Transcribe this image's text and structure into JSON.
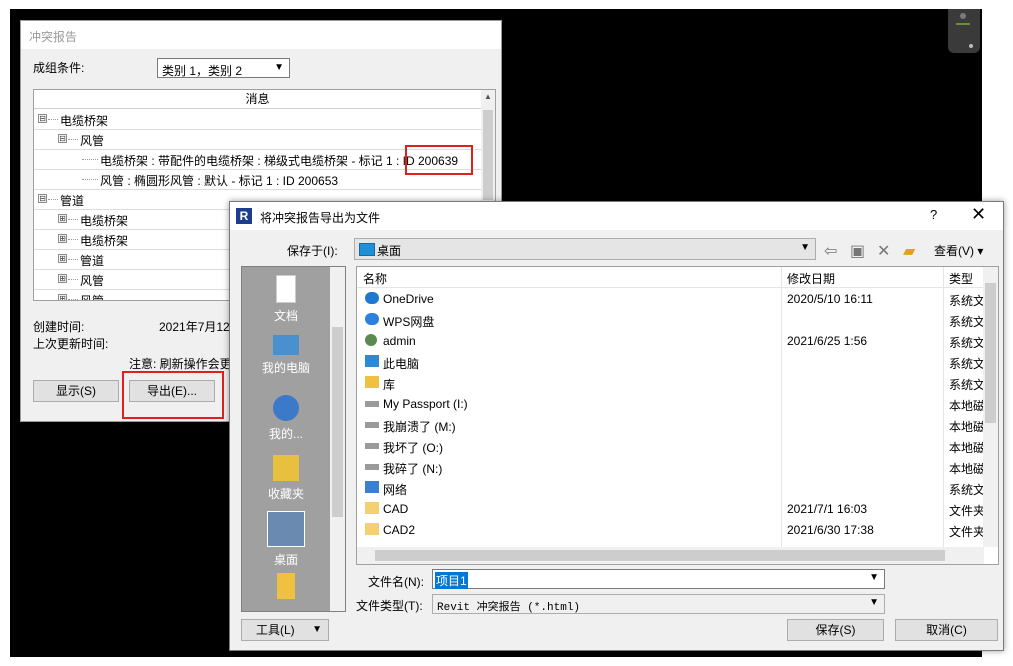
{
  "clash_report": {
    "title": "冲突报告",
    "group_by_label": "成组条件:",
    "group_by_value": "类别 1，类别 2",
    "tree_header": "消息",
    "tree": [
      {
        "label": "电缆桥架",
        "toggle": "⊟",
        "level": 0
      },
      {
        "label": "风管",
        "toggle": "⊟",
        "level": 1
      },
      {
        "label": "电缆桥架 : 带配件的电缆桥架 : 梯级式电缆桥架 - 标记 1 : ID 200639",
        "toggle": "",
        "level": 2
      },
      {
        "label": "风管 : 椭圆形风管 : 默认 - 标记 1 : ID 200653",
        "toggle": "",
        "level": 2
      },
      {
        "label": "管道",
        "toggle": "⊟",
        "level": 0
      },
      {
        "label": "电缆桥架",
        "toggle": "⊞",
        "level": 1
      },
      {
        "label": "电缆桥架",
        "toggle": "⊞",
        "level": 1
      },
      {
        "label": "管道",
        "toggle": "⊞",
        "level": 1
      },
      {
        "label": "风管",
        "toggle": "⊞",
        "level": 1
      },
      {
        "label": "风管",
        "toggle": "⊞",
        "level": 1
      }
    ],
    "created_label": "创建时间:",
    "created_value": "2021年7月12日",
    "updated_label": "上次更新时间:",
    "note": "注意: 刷新操作会更",
    "show_button": "显示(S)",
    "export_button": "导出(E)..."
  },
  "export_dialog": {
    "title": "将冲突报告导出为文件",
    "help": "?",
    "close": "✕",
    "save_in_label": "保存于(I):",
    "save_in_value": "桌面",
    "view_menu": "查看(V)",
    "places": [
      {
        "label": "文档",
        "icon": "document-icon"
      },
      {
        "label": "我的电脑",
        "icon": "computer-icon"
      },
      {
        "label": "我的...",
        "icon": "network-globe-icon"
      },
      {
        "label": "收藏夹",
        "icon": "favorites-icon"
      },
      {
        "label": "桌面",
        "icon": "desktop-icon"
      }
    ],
    "columns": [
      "名称",
      "修改日期",
      "类型"
    ],
    "files": [
      {
        "name": "OneDrive",
        "date": "2020/5/10 16:11",
        "type": "系统文",
        "icon": "onedrive-icon"
      },
      {
        "name": "WPS网盘",
        "date": "",
        "type": "系统文",
        "icon": "wps-cloud-icon"
      },
      {
        "name": "admin",
        "date": "2021/6/25 1:56",
        "type": "系统文",
        "icon": "user-icon"
      },
      {
        "name": "此电脑",
        "date": "",
        "type": "系统文",
        "icon": "this-pc-icon"
      },
      {
        "name": "库",
        "date": "",
        "type": "系统文",
        "icon": "library-icon"
      },
      {
        "name": "My Passport (I:)",
        "date": "",
        "type": "本地磁",
        "icon": "drive-icon"
      },
      {
        "name": "我崩溃了 (M:)",
        "date": "",
        "type": "本地磁",
        "icon": "drive-icon"
      },
      {
        "name": "我坏了 (O:)",
        "date": "",
        "type": "本地磁",
        "icon": "drive-icon"
      },
      {
        "name": "我碎了 (N:)",
        "date": "",
        "type": "本地磁",
        "icon": "drive-icon"
      },
      {
        "name": "网络",
        "date": "",
        "type": "系统文",
        "icon": "network-icon"
      },
      {
        "name": "CAD",
        "date": "2021/7/1 16:03",
        "type": "文件夹",
        "icon": "folder-icon"
      },
      {
        "name": "CAD2",
        "date": "2021/6/30 17:38",
        "type": "文件夹",
        "icon": "folder-icon"
      }
    ],
    "filename_label": "文件名(N):",
    "filename_value": "项目1",
    "filetype_label": "文件类型(T):",
    "filetype_value": "Revit 冲突报告 (*.html)",
    "tools_button": "工具(L)",
    "save_button": "保存(S)",
    "cancel_button": "取消(C)"
  },
  "colors": {
    "highlight": "#e02020",
    "selection": "#0078d7"
  }
}
